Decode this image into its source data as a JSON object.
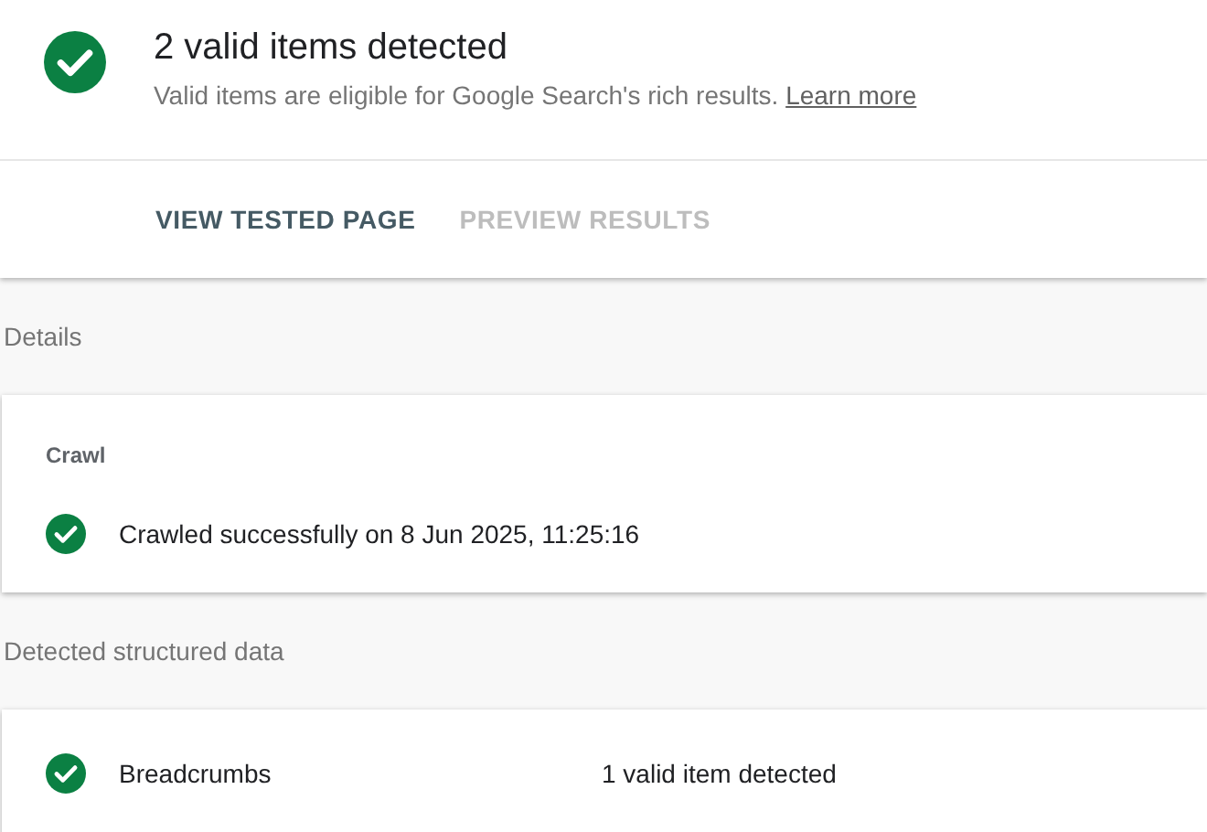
{
  "summary": {
    "valid": true,
    "title": "2 valid items detected",
    "description": "Valid items are eligible for Google Search's rich results.",
    "link": "Learn more",
    "actions": [
      {
        "label": "VIEW TESTED PAGE",
        "disabled": false
      },
      {
        "label": "PREVIEW RESULTS",
        "disabled": true
      }
    ]
  },
  "details": {
    "heading": "Details",
    "card_title": "Crawl",
    "rows": [
      {
        "valid": true,
        "text": "Crawled successfully on 8 Jun 2025, 11:25:16"
      }
    ]
  },
  "structured_data": {
    "heading": "Detected structured data",
    "rows": [
      {
        "valid": true,
        "type": "Breadcrumbs",
        "result": "1 valid item detected"
      }
    ]
  }
}
